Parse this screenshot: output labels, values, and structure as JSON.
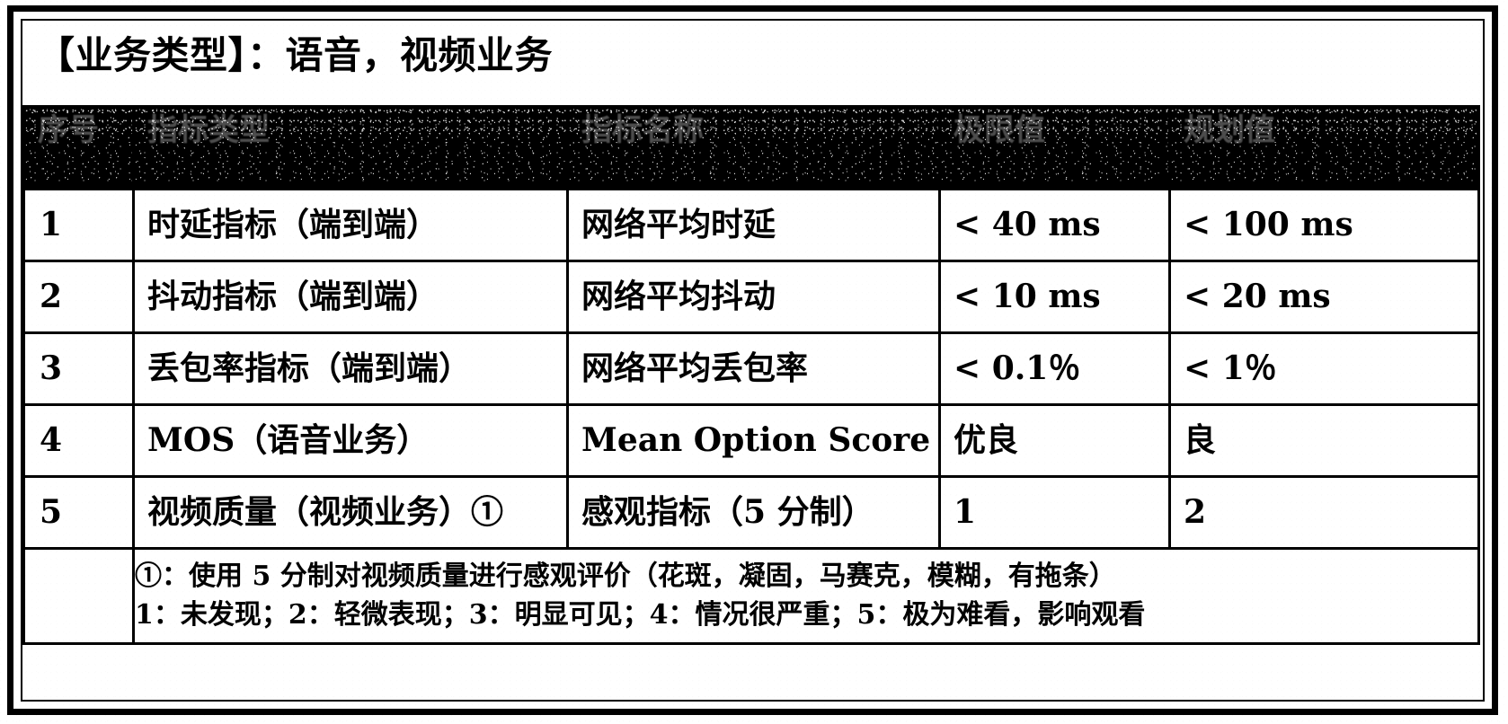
{
  "document": {
    "title_label": "【业务类型】",
    "title_separator": "：",
    "title_value": "语音，视频业务",
    "title_full": "【业务类型】：语音，视频业务"
  },
  "table": {
    "headers": [
      {
        "id": "no",
        "label": "序号"
      },
      {
        "id": "type",
        "label": "指标类型"
      },
      {
        "id": "name",
        "label": "指标名称"
      },
      {
        "id": "lim",
        "label": "极限值"
      },
      {
        "id": "plan",
        "label": "规划值"
      }
    ],
    "rows": [
      {
        "no": "1",
        "type": "时延指标（端到端）",
        "name": "网络平均时延",
        "lim": "< 40 ms",
        "plan": "< 100 ms"
      },
      {
        "no": "2",
        "type": "抖动指标（端到端）",
        "name": "网络平均抖动",
        "lim": "< 10 ms",
        "plan": "< 20 ms"
      },
      {
        "no": "3",
        "type": "丢包率指标（端到端）",
        "name": "网络平均丢包率",
        "lim": "< 0.1％",
        "plan": "< 1％"
      },
      {
        "no": "4",
        "type": "MOS（语音业务）",
        "name": "Mean Option Score",
        "lim": "优良",
        "plan": "良"
      },
      {
        "no": "5",
        "type": "视频质量（视频业务）①",
        "name": "感观指标（5 分制）",
        "lim": "1",
        "plan": "2"
      }
    ],
    "footnote": {
      "no": "",
      "line1": "①：使用 5 分制对视频质量进行感观评价（花斑，凝固，马赛克，模糊，有拖条）",
      "line2": "1：未发现；2：轻微表现；3：明显可见；4：情况很严重；5：极为难看，影响观看"
    }
  },
  "colors": {
    "ink": "#000000",
    "paper": "#ffffff",
    "header_background": "#000000",
    "header_text": "#ffffff"
  }
}
